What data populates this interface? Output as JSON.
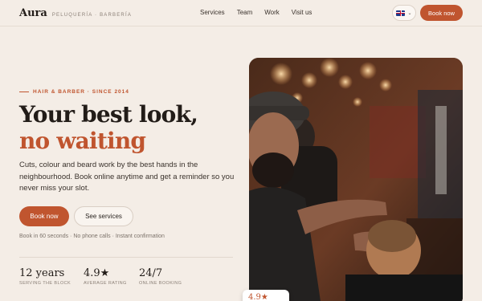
{
  "brand": {
    "name": "Aura",
    "tagline": "PELUQUERÍA · BARBERÍA"
  },
  "nav": {
    "items": [
      "Services",
      "Team",
      "Work",
      "Visit us"
    ]
  },
  "language": {
    "selected": "English (UK)",
    "icon": "uk-flag-icon"
  },
  "header": {
    "book_label": "Book now"
  },
  "hero": {
    "eyebrow": "HAIR & BARBER · SINCE 2014",
    "title_line1": "Your best look,",
    "title_line2": "no waiting",
    "lead": "Cuts, colour and beard work by the best hands in the neighbourhood. Book online anytime and get a reminder so you never miss your slot.",
    "primary_cta": "Book now",
    "secondary_cta": "See services",
    "microcopy": "Book in 60 seconds · No phone calls · Instant confirmation",
    "stats": [
      {
        "value": "12 years",
        "label": "SERVING THE BLOCK"
      },
      {
        "value": "4.9★",
        "label": "AVERAGE RATING"
      },
      {
        "value": "24/7",
        "label": "ONLINE BOOKING"
      }
    ],
    "floating_rating": "4.9★"
  },
  "colors": {
    "accent": "#c0552f",
    "background": "#f4ede6",
    "text": "#221c18"
  }
}
